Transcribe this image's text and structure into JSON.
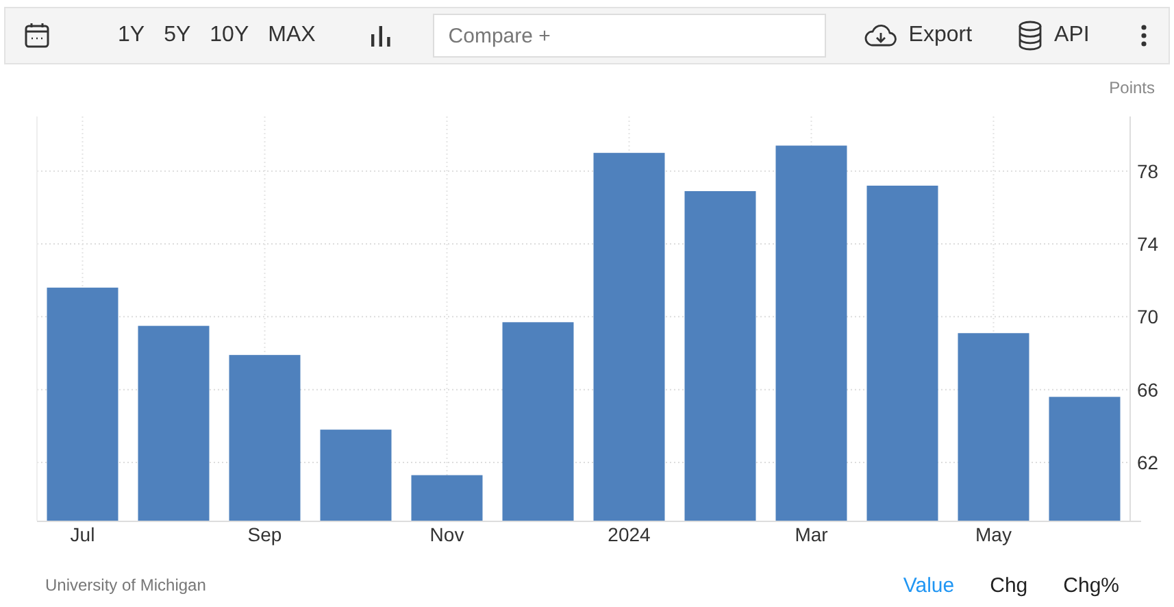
{
  "toolbar": {
    "ranges": [
      "1Y",
      "5Y",
      "10Y",
      "MAX"
    ],
    "compare": {
      "placeholder": "Compare +"
    },
    "export": "Export",
    "api": "API"
  },
  "chart": {
    "unit": "Points",
    "chart_data": {
      "type": "bar",
      "categories": [
        "Jul",
        null,
        "Sep",
        null,
        "Nov",
        null,
        "2024",
        null,
        "Mar",
        null,
        "May",
        null
      ],
      "series": [
        {
          "color": "#4f81bd",
          "values": [
            71.6,
            69.5,
            67.9,
            63.8,
            61.3,
            69.7,
            79.0,
            76.9,
            79.4,
            77.2,
            69.1,
            65.6
          ]
        }
      ],
      "ylim": [
        58.8,
        81
      ],
      "yticks": [
        62,
        66,
        70,
        74,
        78
      ],
      "grid": true
    }
  },
  "footer": {
    "source": "University of Michigan",
    "views": [
      {
        "label": "Value",
        "selected": true
      },
      {
        "label": "Chg",
        "selected": false
      },
      {
        "label": "Chg%",
        "selected": false
      }
    ]
  }
}
